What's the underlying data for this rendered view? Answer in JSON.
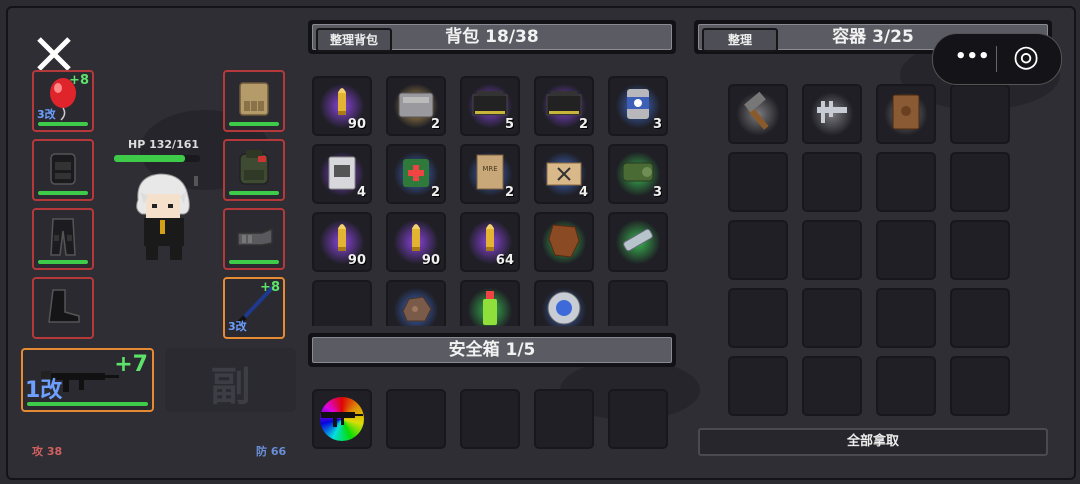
{
  "close_label": "✕",
  "character": {
    "hp_text": "HP 132/161",
    "hp_fraction": 0.82
  },
  "stats": {
    "attack": "攻 38",
    "defense": "防 66"
  },
  "left_slots": {
    "balloon": {
      "plus": "+8",
      "mod": "3改"
    },
    "rifle_mod": "1改",
    "rifle_plus": "+7",
    "secondary_label": "副",
    "sword": {
      "plus": "+8",
      "mod": "3改"
    }
  },
  "backpack": {
    "sort_button": "整理背包",
    "title": "背包 18/38",
    "items": [
      {
        "icon": "bullet-icon",
        "count": "90",
        "glow": "#7b3fc4"
      },
      {
        "icon": "gray-case-icon",
        "count": "2",
        "glow": "#b08f4a"
      },
      {
        "icon": "ammo-box-icon",
        "count": "5",
        "glow": "#7b3fc4"
      },
      {
        "icon": "ammo-box-icon",
        "count": "2",
        "glow": "#7b3fc4"
      },
      {
        "icon": "can-icon",
        "count": "3",
        "glow": "#3d62b8"
      },
      {
        "icon": "foil-pack-icon",
        "count": "4",
        "glow": "#7b3fc4"
      },
      {
        "icon": "medkit-icon",
        "count": "2",
        "glow": "#3d62b8"
      },
      {
        "icon": "mre-bag-icon",
        "count": "2",
        "glow": "#3d62b8"
      },
      {
        "icon": "ration-box-icon",
        "count": "4",
        "glow": "#3d62b8"
      },
      {
        "icon": "green-tape-icon",
        "count": "3",
        "glow": "#35a34a"
      },
      {
        "icon": "bullet-icon",
        "count": "90",
        "glow": "#7b3fc4"
      },
      {
        "icon": "bullet-icon",
        "count": "90",
        "glow": "#7b3fc4"
      },
      {
        "icon": "bullet-icon",
        "count": "64",
        "glow": "#7b3fc4"
      },
      {
        "icon": "leather-icon",
        "count": "",
        "glow": "#35a34a"
      },
      {
        "icon": "flashlight-icon",
        "count": "",
        "glow": "#35a34a"
      },
      {
        "icon": "empty",
        "count": "",
        "glow": ""
      },
      {
        "icon": "ore-icon",
        "count": "",
        "glow": "#3d62b8"
      },
      {
        "icon": "drink-bottle-icon",
        "count": "",
        "glow": "#35a34a"
      },
      {
        "icon": "bearing-icon",
        "count": "",
        "glow": "#3d62b8"
      },
      {
        "icon": "empty",
        "count": "",
        "glow": ""
      }
    ]
  },
  "safe_box": {
    "title": "安全箱 1/5"
  },
  "container": {
    "sort_button": "整理",
    "title": "容器 3/25",
    "take_all": "全部拿取"
  },
  "miniprogram": {
    "more": "•••",
    "target": "◎"
  }
}
